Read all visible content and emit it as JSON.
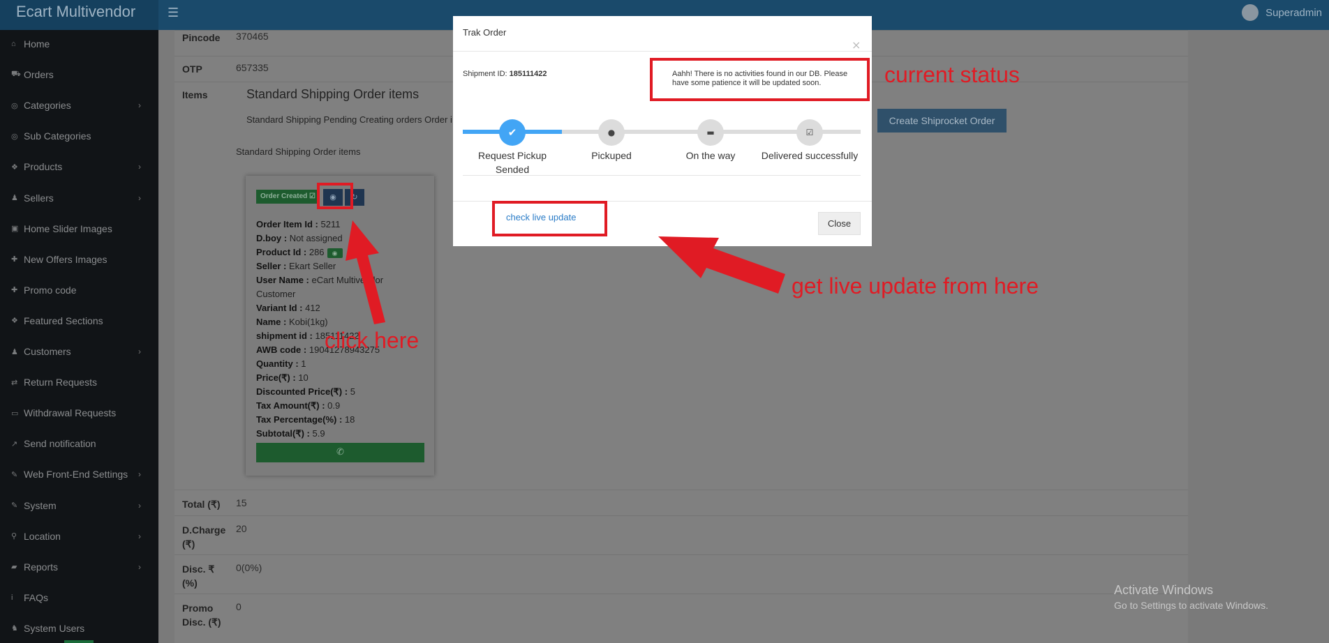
{
  "header": {
    "brand": "Ecart Multivendor",
    "user_name": "Superadmin"
  },
  "sidebar": {
    "items": [
      {
        "label": "Home",
        "icon": "home-icon",
        "has_children": false
      },
      {
        "label": "Orders",
        "icon": "cart-icon",
        "has_children": false
      },
      {
        "label": "Categories",
        "icon": "bullseye-icon",
        "has_children": true
      },
      {
        "label": "Sub Categories",
        "icon": "bullseye-icon",
        "has_children": false
      },
      {
        "label": "Products",
        "icon": "cubes-icon",
        "has_children": true
      },
      {
        "label": "Sellers",
        "icon": "person-icon",
        "has_children": true
      },
      {
        "label": "Home Slider Images",
        "icon": "image-icon",
        "has_children": false
      },
      {
        "label": "New Offers Images",
        "icon": "gift-icon",
        "has_children": false
      },
      {
        "label": "Promo code",
        "icon": "gift-icon",
        "has_children": false
      },
      {
        "label": "Featured Sections",
        "icon": "cubes-icon",
        "has_children": false
      },
      {
        "label": "Customers",
        "icon": "person-icon",
        "has_children": true
      },
      {
        "label": "Return Requests",
        "icon": "exchange-icon",
        "has_children": false
      },
      {
        "label": "Withdrawal Requests",
        "icon": "credit-card-icon",
        "has_children": false
      },
      {
        "label": "Send notification",
        "icon": "share-icon",
        "has_children": false
      },
      {
        "label": "Web Front-End Settings",
        "icon": "wrench-icon",
        "has_children": true
      },
      {
        "label": "System",
        "icon": "wrench-icon",
        "has_children": true
      },
      {
        "label": "Location",
        "icon": "map-marker-icon",
        "has_children": true
      },
      {
        "label": "Reports",
        "icon": "folder-icon",
        "has_children": true
      },
      {
        "label": "FAQs",
        "icon": "info-icon",
        "has_children": false
      },
      {
        "label": "System Users",
        "icon": "users-icon",
        "has_children": false
      }
    ]
  },
  "details": {
    "pincode_label": "Pincode",
    "pincode": "370465",
    "otp_label": "OTP",
    "otp": "657335",
    "items_label": "Items",
    "std_title": "Standard Shipping Order items",
    "std_pending": "Standard Shipping Pending Creating orders Order i",
    "std_sub": "Standard Shipping Order items",
    "shiprocket_button": "Create Shiprocket Order",
    "total_label": "Total (₹)",
    "total": "15",
    "dcharge_label": "D.Charge (₹)",
    "dcharge": "20",
    "disc_label": "Disc. ₹ (%)",
    "disc": "0(0%)",
    "promo_label": "Promo Disc. (₹)",
    "promo": "0"
  },
  "item_card": {
    "status_badge": "Order Created ☑",
    "fields": [
      {
        "label": "Order Item Id :",
        "value": "5211"
      },
      {
        "label": "D.boy :",
        "value": "Not assigned"
      },
      {
        "label": "Product Id :",
        "value": "286"
      },
      {
        "label": "Seller :",
        "value": "Ekart Seller"
      },
      {
        "label": "User Name :",
        "value": "eCart Multivendor Customer"
      },
      {
        "label": "Variant Id :",
        "value": "412"
      },
      {
        "label": "Name :",
        "value": "Kobi(1kg)"
      },
      {
        "label": "shipment id :",
        "value": "185111422"
      },
      {
        "label": "AWB code :",
        "value": "19041278943275"
      },
      {
        "label": "Quantity :",
        "value": "1"
      },
      {
        "label": "Price(₹) :",
        "value": "10"
      },
      {
        "label": "Discounted Price(₹) :",
        "value": "5"
      },
      {
        "label": "Tax Amount(₹) :",
        "value": "0.9"
      },
      {
        "label": "Tax Percentage(%) :",
        "value": "18"
      },
      {
        "label": "Subtotal(₹) :",
        "value": "5.9"
      }
    ]
  },
  "modal": {
    "title": "Trak Order",
    "shipment_label": "Shipment ID:",
    "shipment_id": "185111422",
    "no_activity": "Aahh! There is no activities found in our DB. Please have some patience it will be updated soon.",
    "steps": [
      {
        "label": "Request Pickup Sended",
        "active": true
      },
      {
        "label": "Pickuped",
        "active": false
      },
      {
        "label": "On the way",
        "active": false
      },
      {
        "label": "Delivered successfully",
        "active": false
      }
    ],
    "live_link": "check live update",
    "close_button": "Close"
  },
  "annotations": {
    "current_status": "current status",
    "click_here": "click here",
    "live_update": "get live update from here"
  },
  "watermark": {
    "title": "Activate Windows",
    "subtitle": "Go to Settings to activate Windows."
  },
  "colors": {
    "annotation_red": "#e01b24",
    "progress_blue": "#42a5f5",
    "sidebar_bg": "#111417",
    "header_bg": "#1a4a6b"
  }
}
